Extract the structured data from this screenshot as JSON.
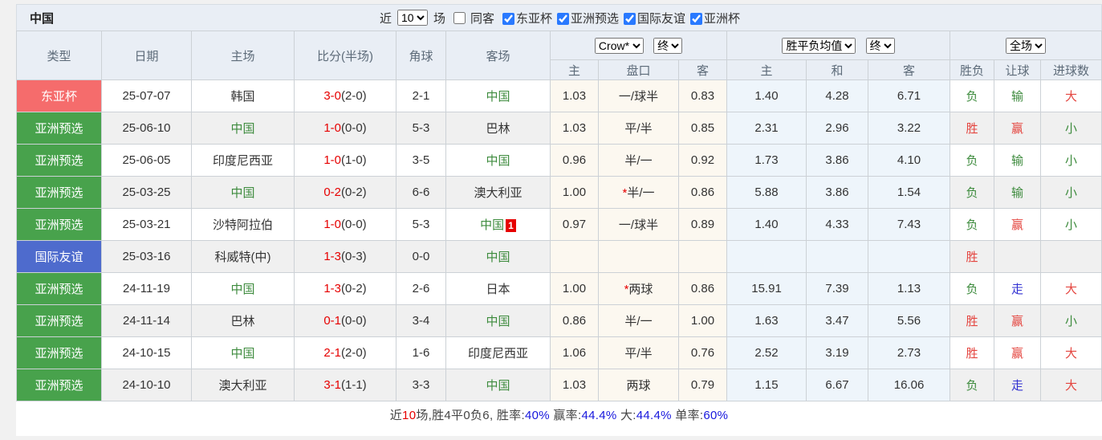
{
  "header_bar": {
    "title": "中国",
    "recent_label": "近",
    "recent_select_value": "10",
    "games_label": "场",
    "same_venue": {
      "label": "同客",
      "checked": false
    },
    "filters": [
      {
        "label": "东亚杯",
        "checked": true
      },
      {
        "label": "亚洲预选",
        "checked": true
      },
      {
        "label": "国际友谊",
        "checked": true
      },
      {
        "label": "亚洲杯",
        "checked": true
      }
    ]
  },
  "table": {
    "columns": [
      "类型",
      "日期",
      "主场",
      "比分(半场)",
      "角球",
      "客场"
    ],
    "odds_company_select": "Crow*",
    "odds_time_select": "终",
    "avg_select": "胜平负均值",
    "avg_time_select": "终",
    "scope_select": "全场",
    "sub_headers": [
      "主",
      "盘口",
      "客",
      "主",
      "和",
      "客",
      "胜负",
      "让球",
      "进球数"
    ],
    "rows": [
      {
        "type": "东亚杯",
        "type_key": "cup",
        "date": "25-07-07",
        "home": {
          "name": "韩国",
          "china": false
        },
        "score": "3-0",
        "half": "(2-0)",
        "corner": "2-1",
        "away": {
          "name": "中国",
          "china": true,
          "red_card": ""
        },
        "odds_home": "1.03",
        "handicap": "一/球半",
        "odds_away": "0.83",
        "avg_home": "1.40",
        "avg_draw": "4.28",
        "avg_away": "6.71",
        "res_wl": {
          "text": "负",
          "color": "green"
        },
        "res_handicap": {
          "text": "输",
          "color": "green"
        },
        "res_goals": {
          "text": "大",
          "color": "red"
        }
      },
      {
        "type": "亚洲预选",
        "type_key": "qual",
        "date": "25-06-10",
        "home": {
          "name": "中国",
          "china": true
        },
        "score": "1-0",
        "half": "(0-0)",
        "corner": "5-3",
        "away": {
          "name": "巴林",
          "china": false,
          "red_card": ""
        },
        "odds_home": "1.03",
        "handicap": "平/半",
        "odds_away": "0.85",
        "avg_home": "2.31",
        "avg_draw": "2.96",
        "avg_away": "3.22",
        "res_wl": {
          "text": "胜",
          "color": "red"
        },
        "res_handicap": {
          "text": "赢",
          "color": "red"
        },
        "res_goals": {
          "text": "小",
          "color": "green"
        }
      },
      {
        "type": "亚洲预选",
        "type_key": "qual",
        "date": "25-06-05",
        "home": {
          "name": "印度尼西亚",
          "china": false
        },
        "score": "1-0",
        "half": "(1-0)",
        "corner": "3-5",
        "away": {
          "name": "中国",
          "china": true,
          "red_card": ""
        },
        "odds_home": "0.96",
        "handicap": "半/一",
        "odds_away": "0.92",
        "avg_home": "1.73",
        "avg_draw": "3.86",
        "avg_away": "4.10",
        "res_wl": {
          "text": "负",
          "color": "green"
        },
        "res_handicap": {
          "text": "输",
          "color": "green"
        },
        "res_goals": {
          "text": "小",
          "color": "green"
        }
      },
      {
        "type": "亚洲预选",
        "type_key": "qual",
        "date": "25-03-25",
        "home": {
          "name": "中国",
          "china": true
        },
        "score": "0-2",
        "half": "(0-2)",
        "corner": "6-6",
        "away": {
          "name": "澳大利亚",
          "china": false,
          "red_card": ""
        },
        "odds_home": "1.00",
        "handicap": "*半/一",
        "odds_away": "0.86",
        "avg_home": "5.88",
        "avg_draw": "3.86",
        "avg_away": "1.54",
        "res_wl": {
          "text": "负",
          "color": "green"
        },
        "res_handicap": {
          "text": "输",
          "color": "green"
        },
        "res_goals": {
          "text": "小",
          "color": "green"
        }
      },
      {
        "type": "亚洲预选",
        "type_key": "qual",
        "date": "25-03-21",
        "home": {
          "name": "沙特阿拉伯",
          "china": false
        },
        "score": "1-0",
        "half": "(0-0)",
        "corner": "5-3",
        "away": {
          "name": "中国",
          "china": true,
          "red_card": "1"
        },
        "odds_home": "0.97",
        "handicap": "一/球半",
        "odds_away": "0.89",
        "avg_home": "1.40",
        "avg_draw": "4.33",
        "avg_away": "7.43",
        "res_wl": {
          "text": "负",
          "color": "green"
        },
        "res_handicap": {
          "text": "赢",
          "color": "red"
        },
        "res_goals": {
          "text": "小",
          "color": "green"
        }
      },
      {
        "type": "国际友谊",
        "type_key": "friendly",
        "date": "25-03-16",
        "home": {
          "name": "科威特(中)",
          "china": false
        },
        "score": "1-3",
        "half": "(0-3)",
        "corner": "0-0",
        "away": {
          "name": "中国",
          "china": true,
          "red_card": ""
        },
        "odds_home": "",
        "handicap": "",
        "odds_away": "",
        "avg_home": "",
        "avg_draw": "",
        "avg_away": "",
        "res_wl": {
          "text": "胜",
          "color": "red"
        },
        "res_handicap": {
          "text": "",
          "color": ""
        },
        "res_goals": {
          "text": "",
          "color": ""
        }
      },
      {
        "type": "亚洲预选",
        "type_key": "qual",
        "date": "24-11-19",
        "home": {
          "name": "中国",
          "china": true
        },
        "score": "1-3",
        "half": "(0-2)",
        "corner": "2-6",
        "away": {
          "name": "日本",
          "china": false,
          "red_card": ""
        },
        "odds_home": "1.00",
        "handicap": "*两球",
        "odds_away": "0.86",
        "avg_home": "15.91",
        "avg_draw": "7.39",
        "avg_away": "1.13",
        "res_wl": {
          "text": "负",
          "color": "green"
        },
        "res_handicap": {
          "text": "走",
          "color": "blue"
        },
        "res_goals": {
          "text": "大",
          "color": "red"
        }
      },
      {
        "type": "亚洲预选",
        "type_key": "qual",
        "date": "24-11-14",
        "home": {
          "name": "巴林",
          "china": false
        },
        "score": "0-1",
        "half": "(0-0)",
        "corner": "3-4",
        "away": {
          "name": "中国",
          "china": true,
          "red_card": ""
        },
        "odds_home": "0.86",
        "handicap": "半/一",
        "odds_away": "1.00",
        "avg_home": "1.63",
        "avg_draw": "3.47",
        "avg_away": "5.56",
        "res_wl": {
          "text": "胜",
          "color": "red"
        },
        "res_handicap": {
          "text": "赢",
          "color": "red"
        },
        "res_goals": {
          "text": "小",
          "color": "green"
        }
      },
      {
        "type": "亚洲预选",
        "type_key": "qual",
        "date": "24-10-15",
        "home": {
          "name": "中国",
          "china": true
        },
        "score": "2-1",
        "half": "(2-0)",
        "corner": "1-6",
        "away": {
          "name": "印度尼西亚",
          "china": false,
          "red_card": ""
        },
        "odds_home": "1.06",
        "handicap": "平/半",
        "odds_away": "0.76",
        "avg_home": "2.52",
        "avg_draw": "3.19",
        "avg_away": "2.73",
        "res_wl": {
          "text": "胜",
          "color": "red"
        },
        "res_handicap": {
          "text": "赢",
          "color": "red"
        },
        "res_goals": {
          "text": "大",
          "color": "red"
        }
      },
      {
        "type": "亚洲预选",
        "type_key": "qual",
        "date": "24-10-10",
        "home": {
          "name": "澳大利亚",
          "china": false
        },
        "score": "3-1",
        "half": "(1-1)",
        "corner": "3-3",
        "away": {
          "name": "中国",
          "china": true,
          "red_card": ""
        },
        "odds_home": "1.03",
        "handicap": "两球",
        "odds_away": "0.79",
        "avg_home": "1.15",
        "avg_draw": "6.67",
        "avg_away": "16.06",
        "res_wl": {
          "text": "负",
          "color": "green"
        },
        "res_handicap": {
          "text": "走",
          "color": "blue"
        },
        "res_goals": {
          "text": "大",
          "color": "red"
        }
      }
    ]
  },
  "footer": {
    "segments": [
      {
        "text": "近",
        "color": "dark"
      },
      {
        "text": "10",
        "color": "red"
      },
      {
        "text": "场,胜4平0负6, 胜率:",
        "color": "dark"
      },
      {
        "text": "40%",
        "color": "blue"
      },
      {
        "text": " 赢率:",
        "color": "dark"
      },
      {
        "text": "44.4%",
        "color": "blue"
      },
      {
        "text": " 大:",
        "color": "dark"
      },
      {
        "text": "44.4%",
        "color": "blue"
      },
      {
        "text": " 单率:",
        "color": "dark"
      },
      {
        "text": "60%",
        "color": "blue"
      }
    ]
  },
  "colors": {
    "type_cup": "#f56c6c",
    "type_qual": "#48a24c",
    "type_friendly": "#4e6bcd",
    "china_green": "#3d8b3d",
    "score_red": "#e60000",
    "result_red": "#e4453f",
    "result_green": "#3d8b3d",
    "result_blue": "#3232d2",
    "odds_bg": "#fcf8f0",
    "avg_bg": "#eef5fb",
    "checkbox_accent": "#2979ff"
  }
}
